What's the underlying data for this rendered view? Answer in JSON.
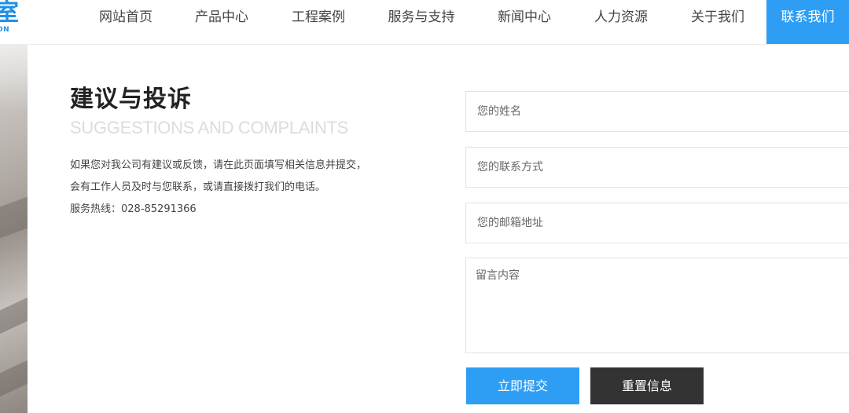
{
  "logo": {
    "mark": "室",
    "sub": "ON"
  },
  "nav": {
    "items": [
      {
        "label": "网站首页"
      },
      {
        "label": "产品中心"
      },
      {
        "label": "工程案例"
      },
      {
        "label": "服务与支持"
      },
      {
        "label": "新闻中心"
      },
      {
        "label": "人力资源"
      },
      {
        "label": "关于我们"
      },
      {
        "label": "联系我们",
        "active": true
      }
    ],
    "accent": "#2e9ef4"
  },
  "section": {
    "title_cn": "建议与投诉",
    "title_en": "SUGGESTIONS AND COMPLAINTS",
    "desc_lines": [
      "如果您对我公司有建议或反馈，请在此页面填写相关信息并提交，",
      "会有工作人员及时与您联系，或请直接拨打我们的电话。",
      "服务热线：028-85291366"
    ]
  },
  "form": {
    "name_placeholder": "您的姓名",
    "contact_placeholder": "您的联系方式",
    "email_placeholder": "您的邮箱地址",
    "message_placeholder": "留言内容",
    "submit_label": "立即提交",
    "reset_label": "重置信息"
  }
}
